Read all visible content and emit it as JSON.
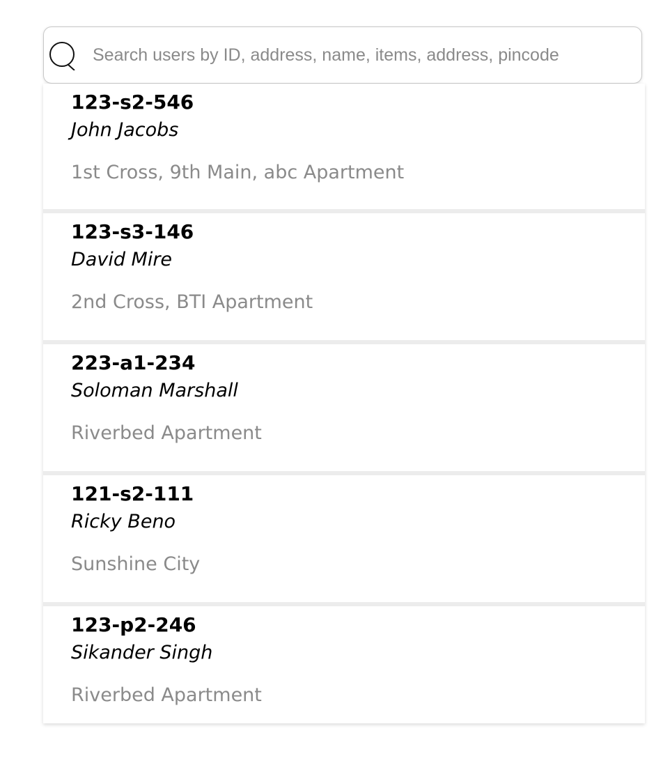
{
  "search": {
    "placeholder": "Search users by ID, address, name, items, address, pincode",
    "value": "",
    "icon": "search-icon"
  },
  "results": [
    {
      "id": "123-s2-546",
      "name": "John Jacobs",
      "address": "1st Cross, 9th Main, abc Apartment"
    },
    {
      "id": "123-s3-146",
      "name": "David Mire",
      "address": "2nd Cross, BTI Apartment"
    },
    {
      "id": "223-a1-234",
      "name": "Soloman Marshall",
      "address": "Riverbed Apartment"
    },
    {
      "id": "121-s2-111",
      "name": "Ricky Beno",
      "address": "Sunshine City"
    },
    {
      "id": "123-p2-246",
      "name": "Sikander Singh",
      "address": "Riverbed Apartment"
    }
  ],
  "colors": {
    "id_text": "#000000",
    "name_text": "#000000",
    "address_text": "#8a8a8a",
    "divider": "#ececec",
    "search_border": "#c8c8c8"
  }
}
